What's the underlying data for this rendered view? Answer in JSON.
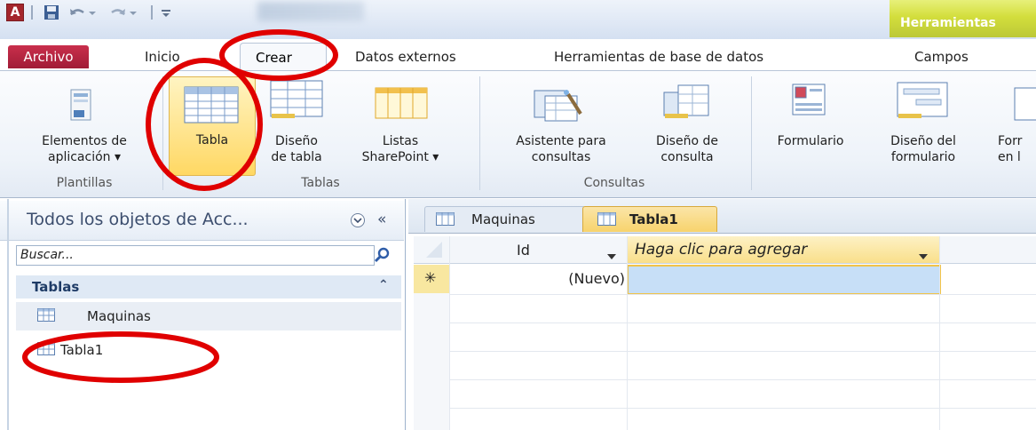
{
  "titlebar": {
    "logo": "A",
    "context_tab": "Herramientas"
  },
  "tabs": [
    {
      "label": "Archivo"
    },
    {
      "label": "Inicio"
    },
    {
      "label": "Crear"
    },
    {
      "label": "Datos externos"
    },
    {
      "label": "Herramientas de base de datos"
    },
    {
      "label": "Campos"
    }
  ],
  "ribbon": {
    "buttons": [
      {
        "label": "Elementos de\naplicación ▾"
      },
      {
        "label": "Tabla"
      },
      {
        "label": "Diseño\nde tabla"
      },
      {
        "label": "Listas\nSharePoint ▾"
      },
      {
        "label": "Asistente para\nconsultas"
      },
      {
        "label": "Diseño de\nconsulta"
      },
      {
        "label": "Formulario"
      },
      {
        "label": "Diseño del\nformulario"
      },
      {
        "label": "Forr\nen l"
      }
    ],
    "groups": [
      {
        "label": "Plantillas"
      },
      {
        "label": "Tablas"
      },
      {
        "label": "Consultas"
      }
    ]
  },
  "nav": {
    "title": "Todos los objetos de Acc...",
    "collapse": "«",
    "search_placeholder": "Buscar...",
    "section": "Tablas",
    "section_toggle": "⌃",
    "items": [
      {
        "label": "Maquinas"
      },
      {
        "label": "Tabla1"
      }
    ]
  },
  "doc": {
    "tabs": [
      {
        "label": "Maquinas"
      },
      {
        "label": "Tabla1"
      }
    ],
    "columns": [
      {
        "label": "Id"
      },
      {
        "label": "Haga clic para agregar"
      }
    ],
    "row_marker": "✳",
    "new_row": "(Nuevo)"
  },
  "colors": {
    "archivo_tab": "#b7213d",
    "highlight": "#ffe38a",
    "annotation": "#e00000",
    "selected_cell": "#c7dff7"
  }
}
